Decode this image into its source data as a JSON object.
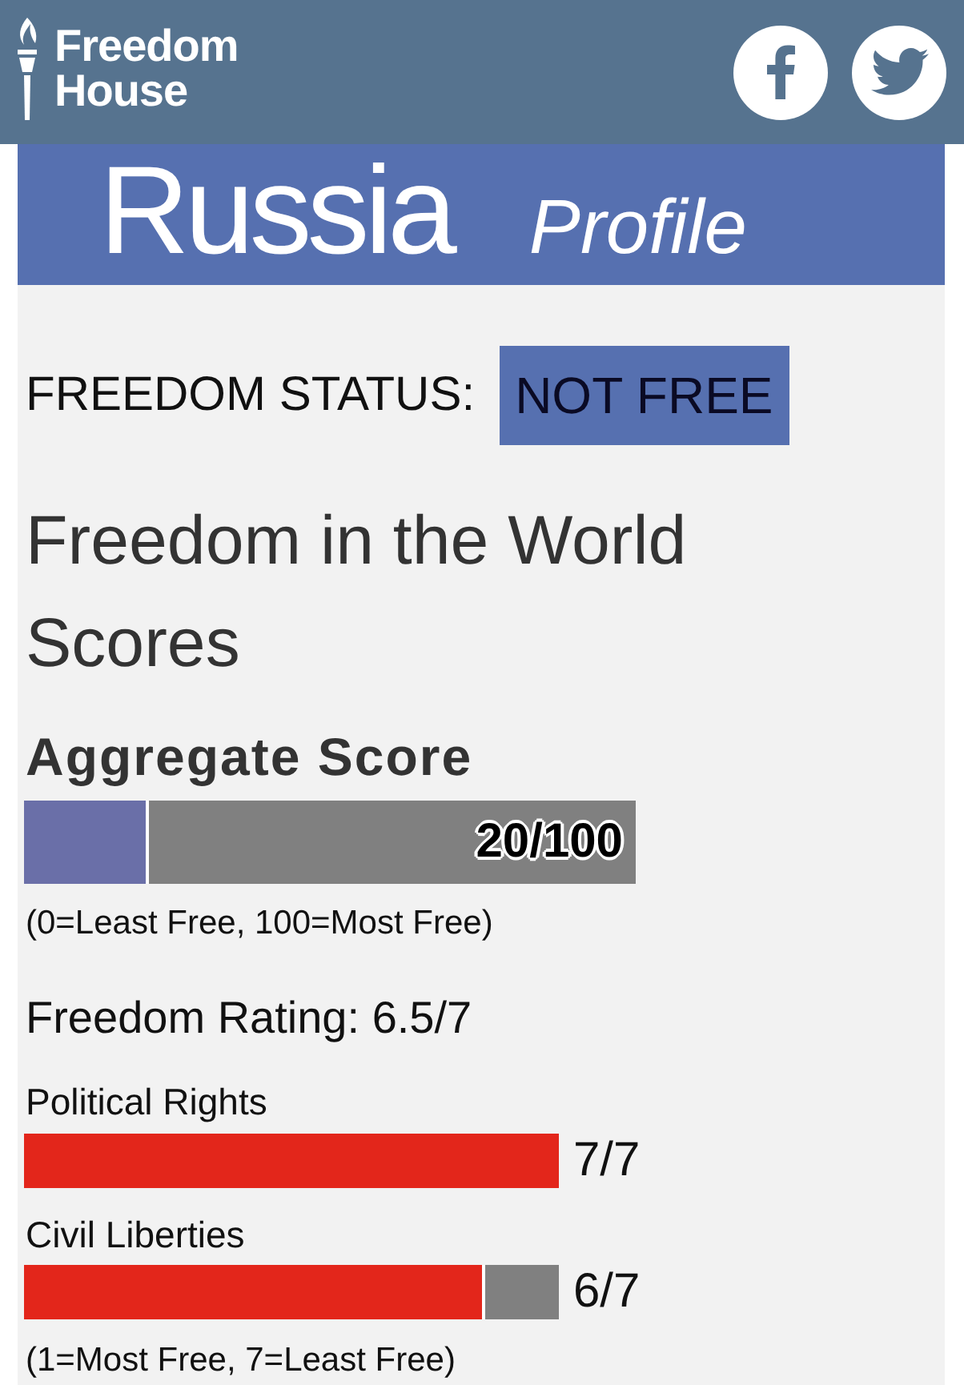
{
  "header": {
    "logo": "Freedom House",
    "social": [
      {
        "kind": "facebook"
      },
      {
        "kind": "twitter"
      }
    ]
  },
  "banner": {
    "country": "Russia",
    "subtitle": "Profile"
  },
  "status": {
    "label": "FREEDOM STATUS:",
    "value": "NOT FREE"
  },
  "scores_heading": "Freedom in the World Scores",
  "aggregate": {
    "title": "Aggregate Score",
    "level": 0.2,
    "reading": "20/100",
    "note": "(0=Least Free, 100=Most Free)"
  },
  "rating": {
    "title": "Freedom Rating: 6.5/7",
    "items": [
      {
        "name": "Political Rights",
        "level": 1,
        "reading": "7/7"
      },
      {
        "name": "Civil Liberties",
        "level": 0.857,
        "reading": "6/7"
      }
    ],
    "note": "(1=Most Free, 7=Least Free)"
  }
}
